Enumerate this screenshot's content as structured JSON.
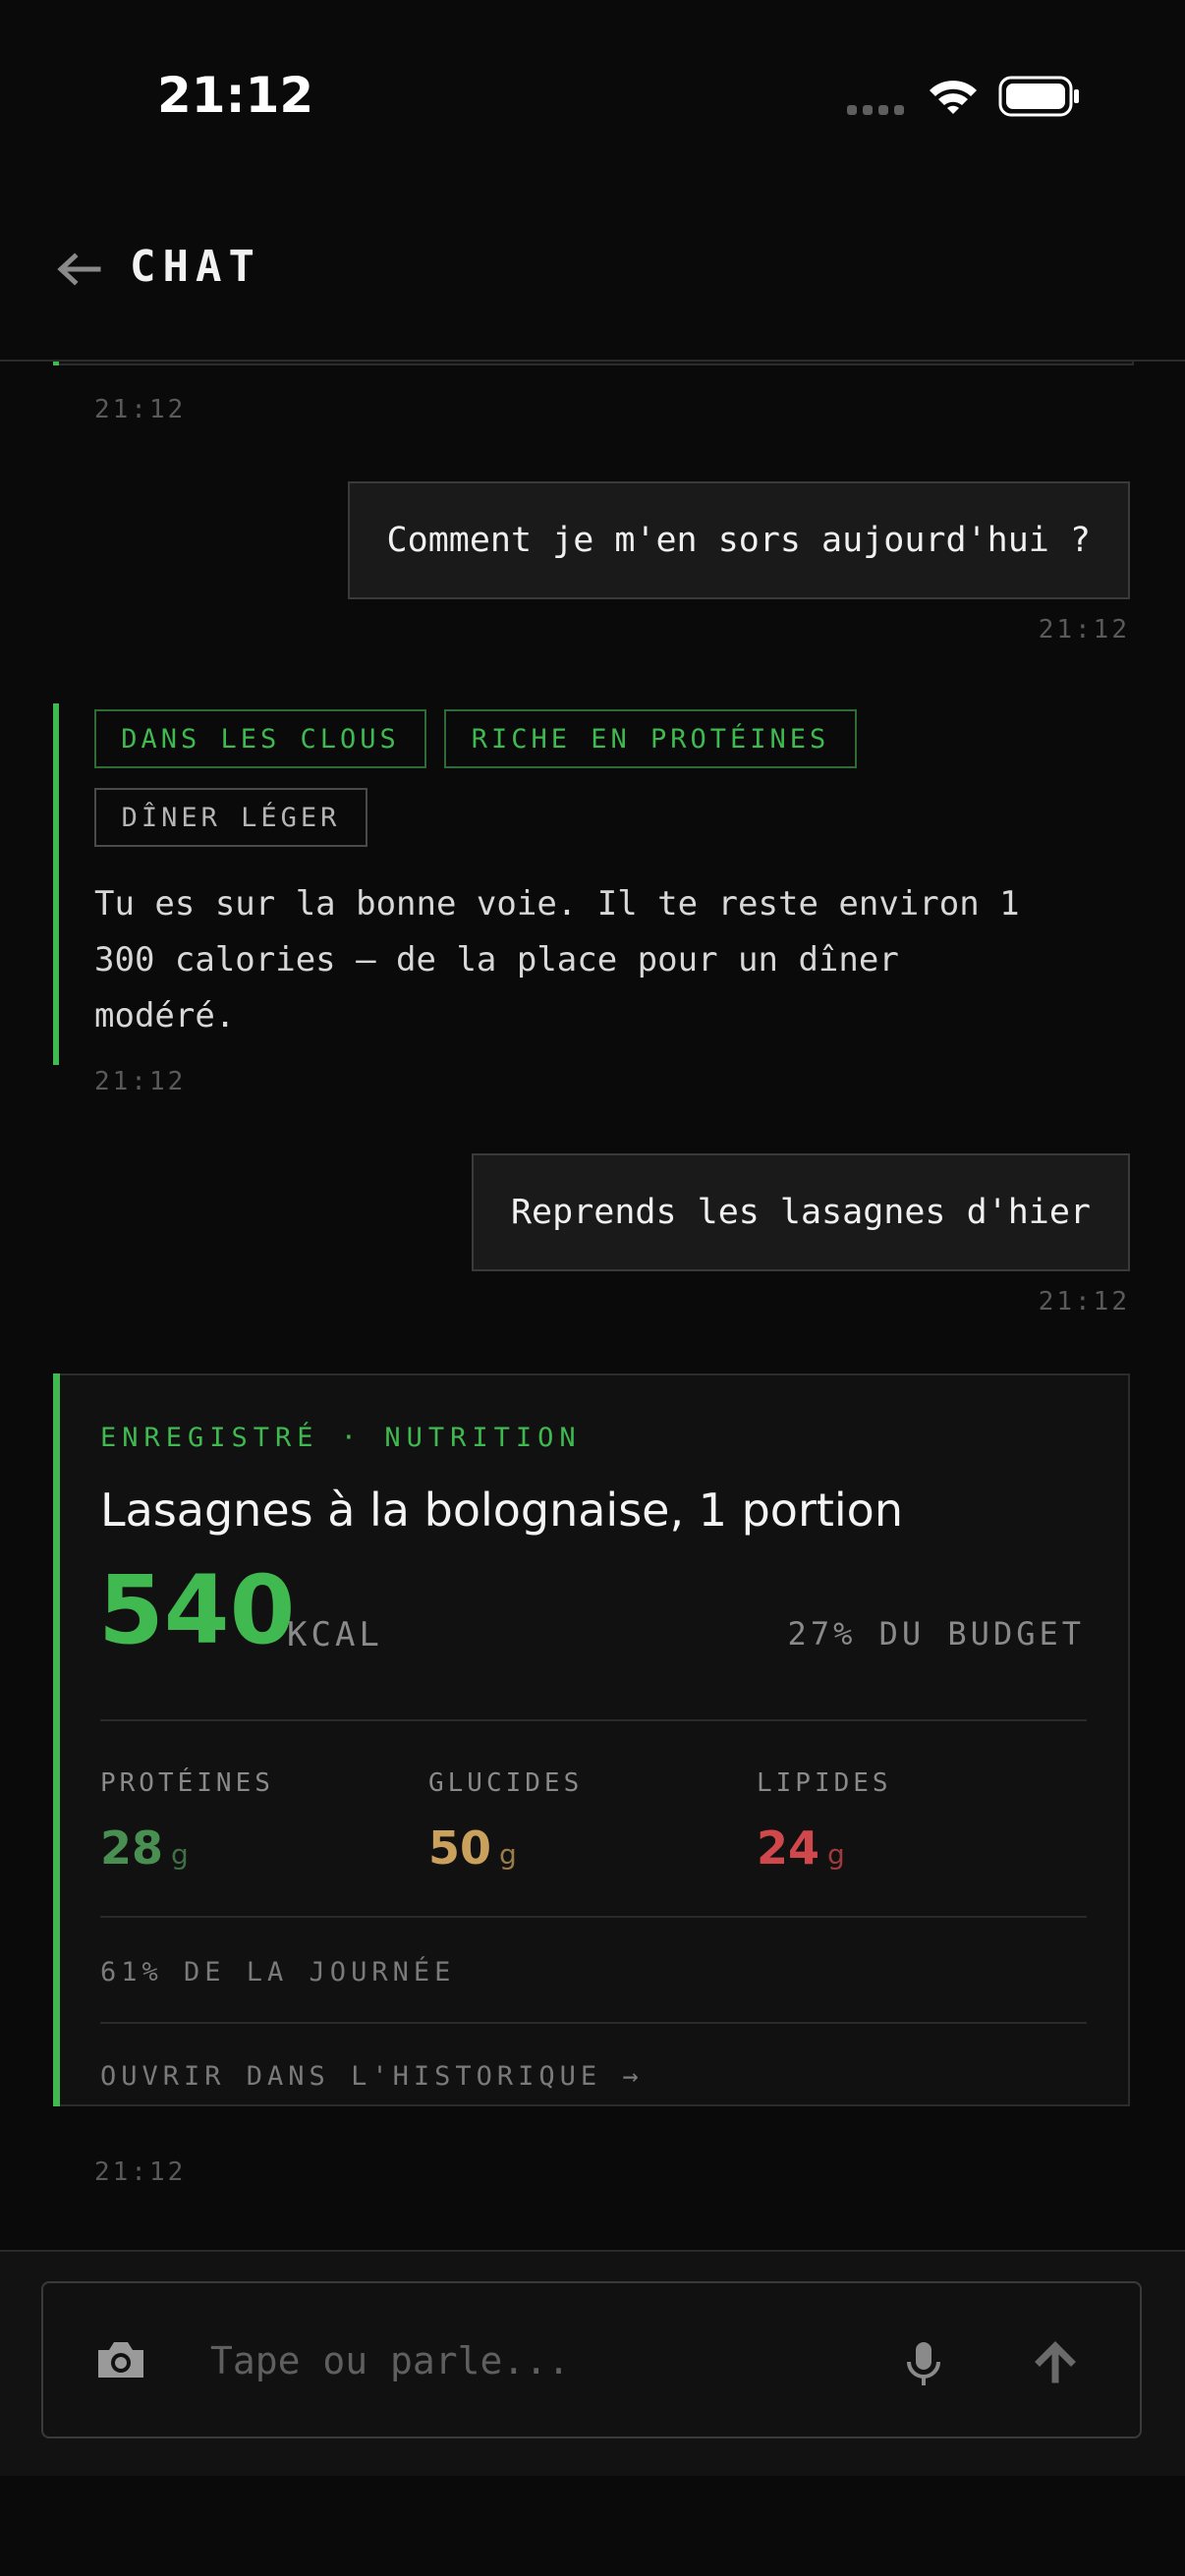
{
  "status_bar": {
    "time": "21:12"
  },
  "header": {
    "title": "CHAT",
    "back_icon": "arrow-left-icon"
  },
  "messages": [
    {
      "role": "assistant",
      "time": "21:12"
    },
    {
      "role": "user",
      "text": "Comment je m'en sors aujourd'hui ?",
      "time": "21:12"
    },
    {
      "role": "assistant",
      "tags": [
        "DANS LES CLOUS",
        "RICHE EN PROTÉINES",
        "DÎNER LÉGER"
      ],
      "text": "Tu es sur la bonne voie. Il te reste environ 1 300 calories — de la place pour un dîner modéré.",
      "time": "21:12"
    },
    {
      "role": "user",
      "text": "Reprends les lasagnes d'hier",
      "time": "21:12"
    },
    {
      "role": "assistant",
      "time": "21:12"
    }
  ],
  "nutrition_card": {
    "kicker": "ENREGISTRÉ · NUTRITION",
    "title": "Lasagnes à la bolognaise, 1 portion",
    "kcal": "540",
    "kcal_unit": "KCAL",
    "budget": "27% DU BUDGET",
    "macros": [
      {
        "label": "PROTÉINES",
        "value": "28",
        "unit": "g",
        "color": "#4a8f52"
      },
      {
        "label": "GLUCIDES",
        "value": "50",
        "unit": "g",
        "color": "#c9a15c"
      },
      {
        "label": "LIPIDES",
        "value": "24",
        "unit": "g",
        "color": "#d0474c"
      }
    ],
    "day_percent": "61% DE LA JOURNÉE",
    "open_history": "OUVRIR DANS L'HISTORIQUE →"
  },
  "composer": {
    "placeholder": "Tape ou parle...",
    "value": ""
  },
  "colors": {
    "accent": "#3fb950",
    "background": "#0a0a0a",
    "surface": "#111111"
  }
}
